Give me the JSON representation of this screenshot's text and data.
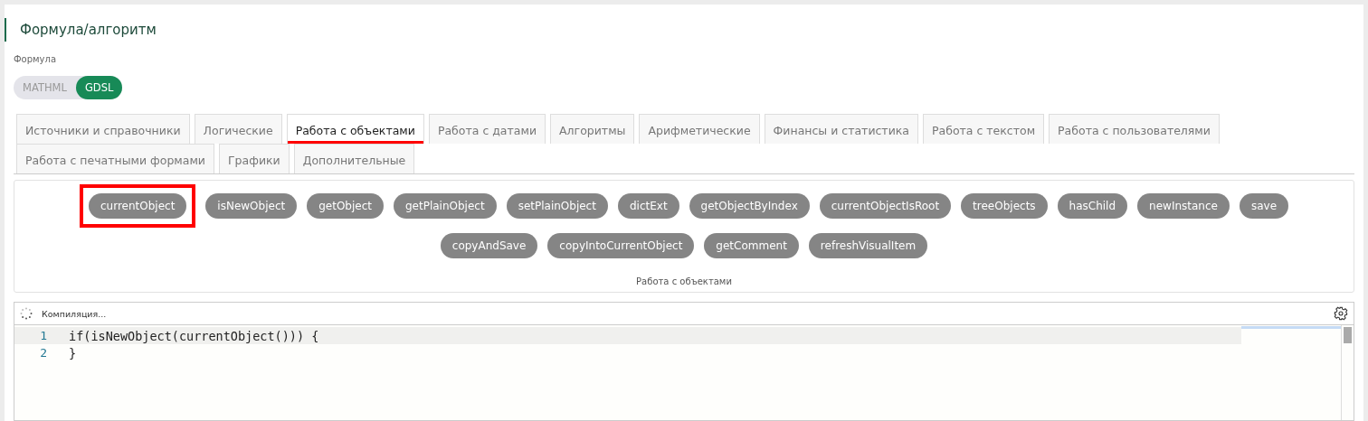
{
  "section_title": "Формула/алгоритм",
  "field_label": "Формула",
  "mode_toggle": [
    {
      "label": "MATHML",
      "selected": false
    },
    {
      "label": "GDSL",
      "selected": true
    }
  ],
  "tab_rows": [
    [
      {
        "label": "Источники и справочники",
        "selected": false
      },
      {
        "label": "Логические",
        "selected": false
      },
      {
        "label": "Работа с объектами",
        "selected": true
      },
      {
        "label": "Работа с датами",
        "selected": false
      },
      {
        "label": "Алгоритмы",
        "selected": false
      },
      {
        "label": "Арифметические",
        "selected": false
      },
      {
        "label": "Финансы и статистика",
        "selected": false
      },
      {
        "label": "Работа с текстом",
        "selected": false
      },
      {
        "label": "Работа с пользователями",
        "selected": false
      }
    ],
    [
      {
        "label": "Работа с печатными формами",
        "selected": false
      },
      {
        "label": "Графики",
        "selected": false
      },
      {
        "label": "Дополнительные",
        "selected": false
      }
    ]
  ],
  "function_rows": [
    [
      {
        "label": "currentObject",
        "highlighted": true
      },
      {
        "label": "isNewObject",
        "highlighted": false
      },
      {
        "label": "getObject",
        "highlighted": false
      },
      {
        "label": "getPlainObject",
        "highlighted": false
      },
      {
        "label": "setPlainObject",
        "highlighted": false
      },
      {
        "label": "dictExt",
        "highlighted": false
      },
      {
        "label": "getObjectByIndex",
        "highlighted": false
      },
      {
        "label": "currentObjectIsRoot",
        "highlighted": false
      },
      {
        "label": "treeObjects",
        "highlighted": false
      },
      {
        "label": "hasChild",
        "highlighted": false
      },
      {
        "label": "newInstance",
        "highlighted": false
      },
      {
        "label": "save",
        "highlighted": false
      }
    ],
    [
      {
        "label": "copyAndSave",
        "highlighted": false
      },
      {
        "label": "copyIntoCurrentObject",
        "highlighted": false
      },
      {
        "label": "getComment",
        "highlighted": false
      },
      {
        "label": "refreshVisualItem",
        "highlighted": false
      }
    ]
  ],
  "group_caption": "Работа с объектами",
  "editor": {
    "status": "Компиляция...",
    "lines": [
      {
        "number": "1",
        "code": "if(isNewObject(currentObject())) {",
        "current": true
      },
      {
        "number": "2",
        "code": "}",
        "current": false
      }
    ]
  }
}
